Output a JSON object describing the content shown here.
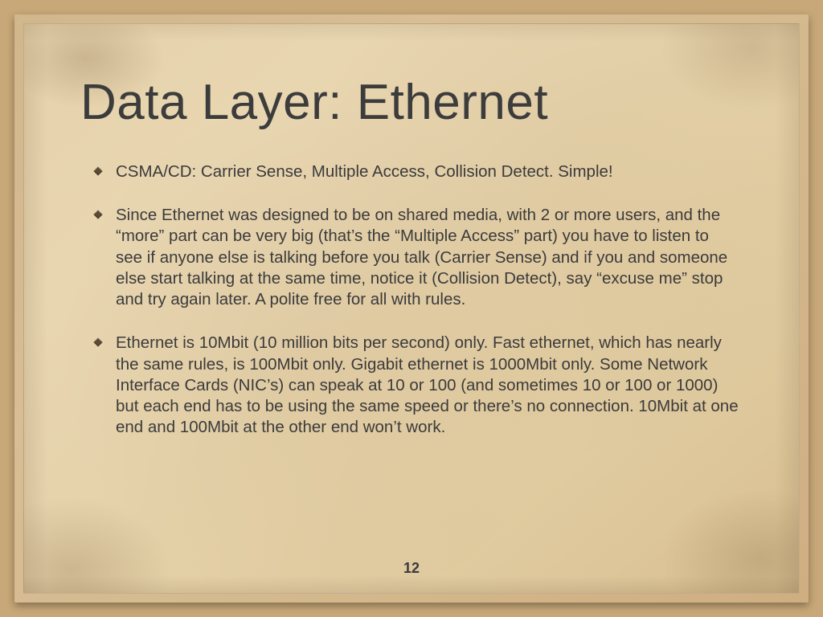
{
  "slide": {
    "title": "Data Layer: Ethernet",
    "bullets": [
      "CSMA/CD: Carrier Sense, Multiple Access, Collision Detect. Simple!",
      "Since Ethernet was designed to be on shared media, with 2 or more users, and the “more” part can be very big (that’s the “Multiple Access” part) you have to listen to see if anyone else is talking before you talk (Carrier Sense) and if you and someone else start talking at the same time, notice it (Collision Detect), say “excuse me” stop and try again later. A polite free for all with rules.",
      "Ethernet is 10Mbit (10 million bits per second) only. Fast ethernet, which has nearly the same rules, is 100Mbit only. Gigabit ethernet is 1000Mbit only. Some Network Interface Cards (NIC’s) can speak at 10 or 100 (and sometimes 10 or 100 or 1000) but each end has to be using the same speed or there’s no connection. 10Mbit at one end and 100Mbit at the other end won’t work."
    ],
    "page_number": "12"
  }
}
